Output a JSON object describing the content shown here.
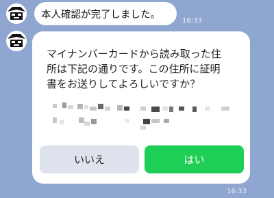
{
  "messages": [
    {
      "text": "本人確認が完了しました。",
      "time": "16:33"
    }
  ],
  "card": {
    "lines": [
      "マイナンバーカードから読み取った住",
      "所は下記の通りです。この住所に証明",
      "書をお送りしてよろしいですか？"
    ],
    "address_redacted": true,
    "buttons": {
      "no": "いいえ",
      "yes": "はい"
    },
    "time": "16:33"
  },
  "colors": {
    "background": "#8fa6d0",
    "bubble": "#ffffff",
    "yes_button": "#1fce55",
    "no_button": "#dde2ec"
  },
  "icons": {
    "avatar": "bot-avatar-icon"
  }
}
